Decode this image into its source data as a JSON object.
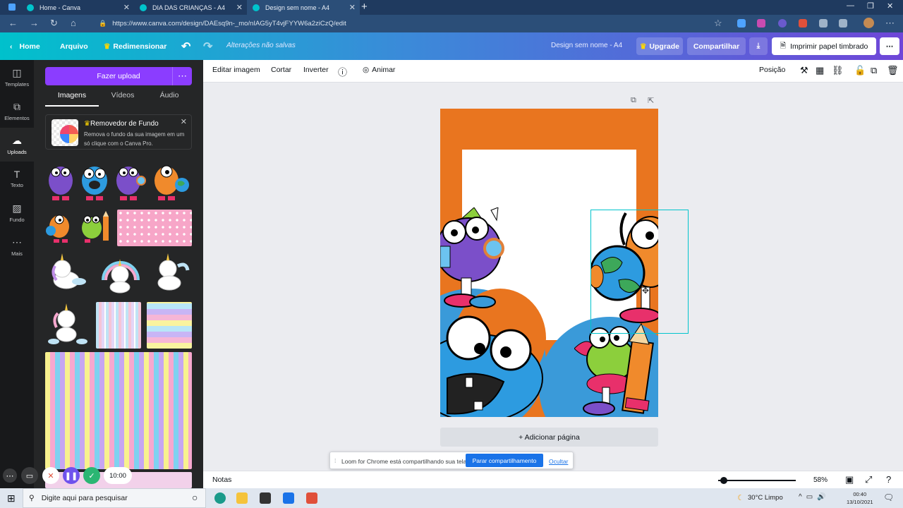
{
  "browser": {
    "tabs": [
      {
        "title": "Home - Canva",
        "active": false
      },
      {
        "title": "DIA DAS CRIANÇAS - A4",
        "active": false
      },
      {
        "title": "Design sem nome - A4",
        "active": true
      }
    ],
    "url": "https://www.canva.com/design/DAEsq9n-_mo/nIAG5yT4vjFYYW6a2ziCzQ/edit"
  },
  "header": {
    "home": "Home",
    "arquivo": "Arquivo",
    "redimensionar": "Redimensionar",
    "saved_status": "Alterações não salvas",
    "doc_title": "Design sem nome - A4",
    "upgrade": "Upgrade",
    "share": "Compartilhar",
    "print": "Imprimir papel timbrado"
  },
  "rail": {
    "items": [
      {
        "label": "Templates",
        "icon": "templates-icon"
      },
      {
        "label": "Elementos",
        "icon": "elements-icon"
      },
      {
        "label": "Uploads",
        "icon": "upload-icon"
      },
      {
        "label": "Texto",
        "icon": "text-icon"
      },
      {
        "label": "Fundo",
        "icon": "background-icon"
      },
      {
        "label": "Mais",
        "icon": "more-icon"
      }
    ]
  },
  "panel": {
    "upload_button": "Fazer upload",
    "tabs": [
      "Imagens",
      "Vídeos",
      "Áudio"
    ],
    "promo_title": "Removedor de Fundo",
    "promo_desc": "Remova o fundo da sua imagem em um só clique com o Canva Pro."
  },
  "toolbar": {
    "edit_image": "Editar imagem",
    "crop": "Cortar",
    "flip": "Inverter",
    "animate": "Animar",
    "position": "Posição"
  },
  "canvas": {
    "add_page": "+ Adicionar página"
  },
  "loom": {
    "timer": "10:00",
    "banner_message": "Loom for Chrome está compartilhando sua tela.",
    "stop_sharing": "Parar compartilhamento",
    "hide": "Ocultar"
  },
  "footer": {
    "notes": "Notas",
    "zoom": "58%"
  },
  "taskbar": {
    "search_placeholder": "Digite aqui para pesquisar",
    "weather": "30°C  Limpo",
    "time": "00:40",
    "date": "13/10/2021"
  },
  "colors": {
    "brand_purple": "#8b3dff",
    "page_orange": "#e9751f",
    "selection_cyan": "#00c4cc"
  }
}
